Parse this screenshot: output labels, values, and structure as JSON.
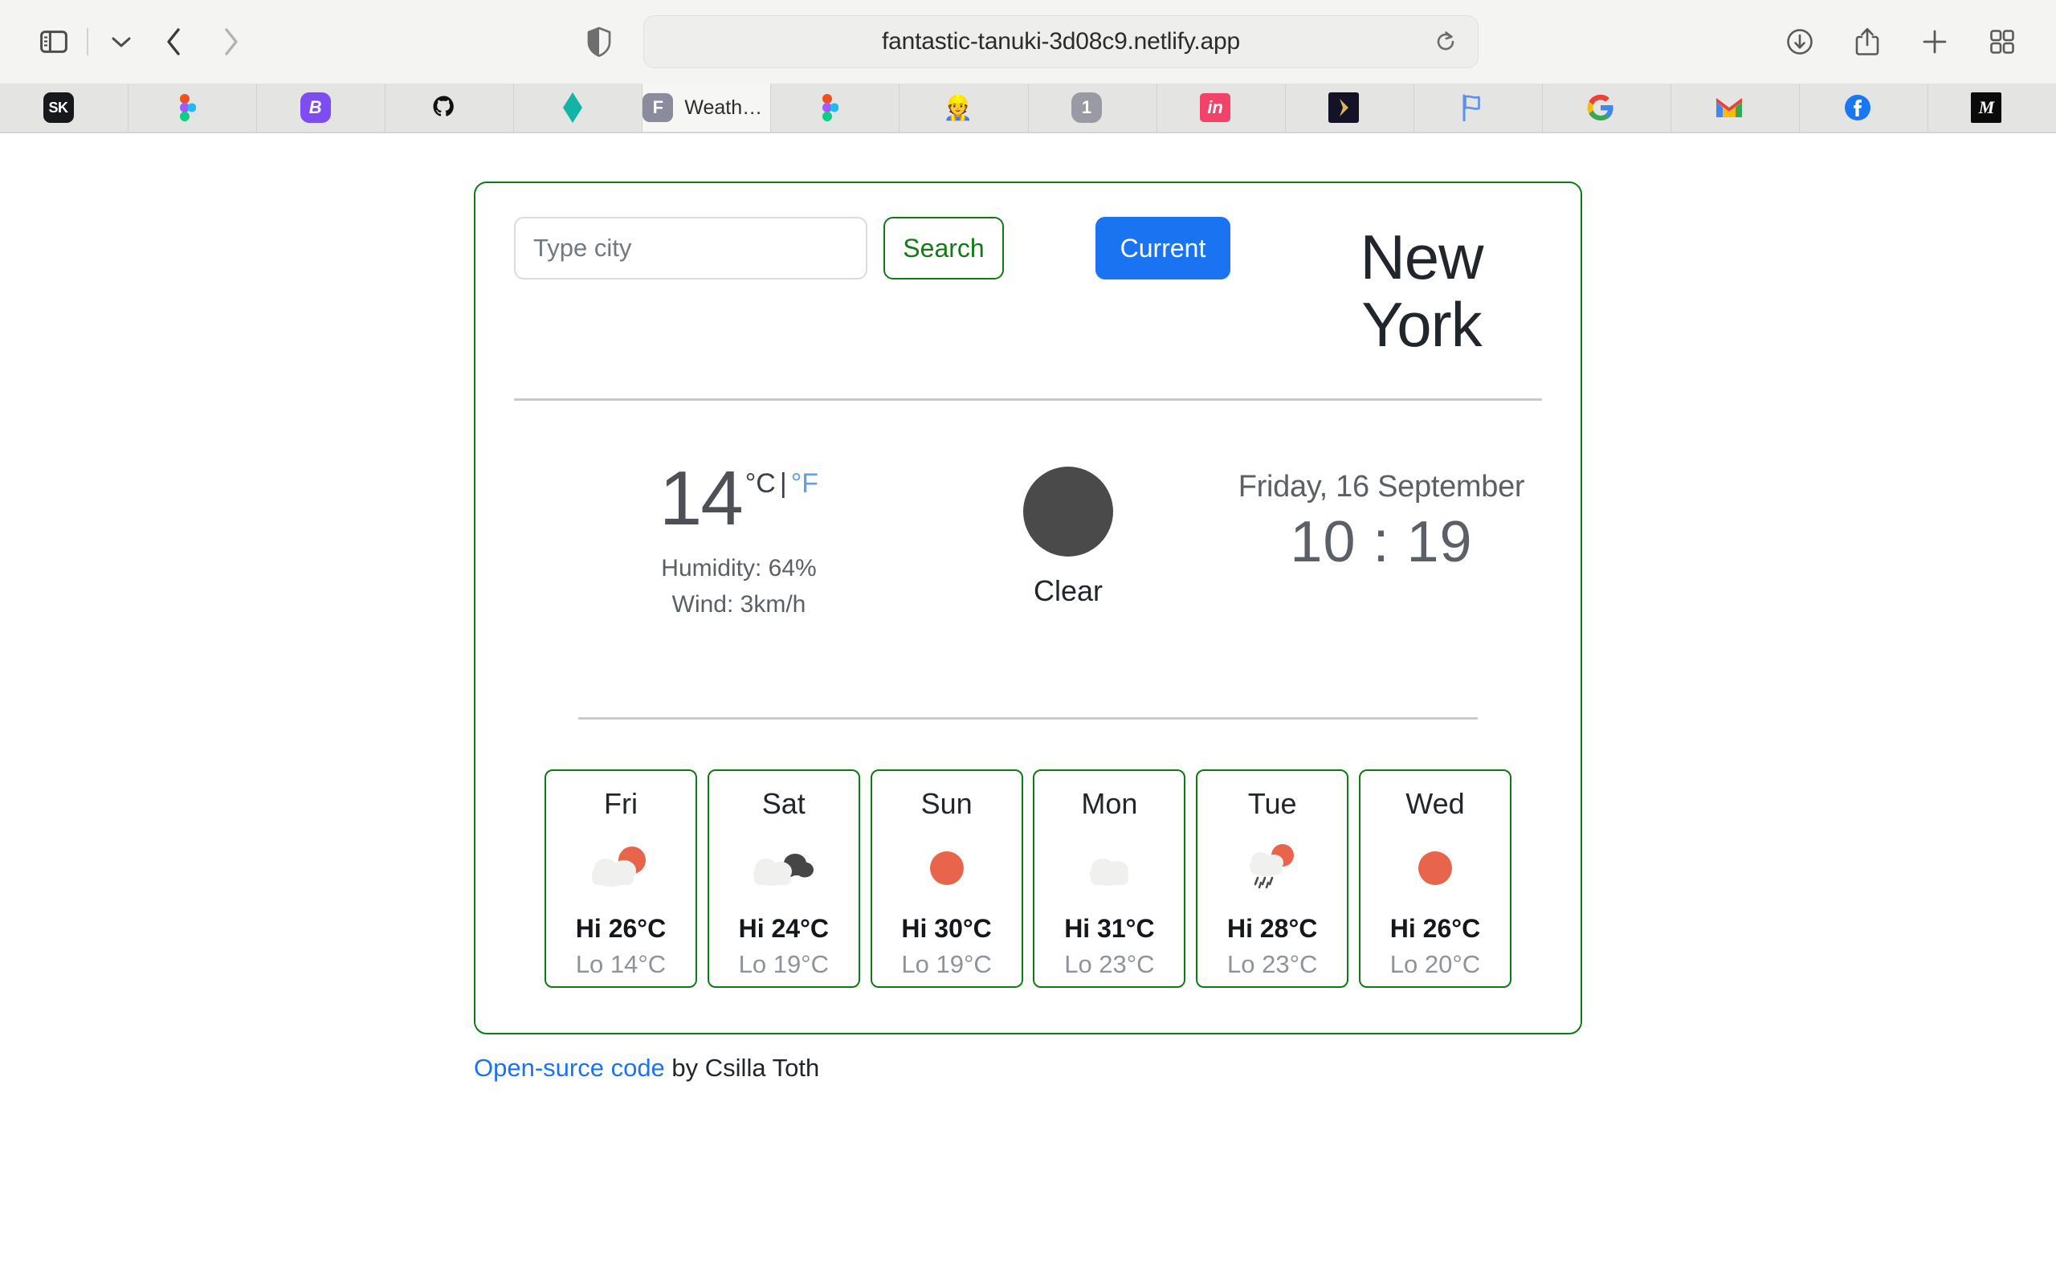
{
  "browser": {
    "url": "fantastic-tanuki-3d08c9.netlify.app",
    "icons": {
      "sidebar": "sidebar-icon",
      "sidebar_chevron": "chevron-down-icon",
      "back": "back-arrow-icon",
      "forward": "forward-arrow-icon",
      "shield": "privacy-shield-icon",
      "reload": "reload-icon",
      "downloads": "downloads-icon",
      "share": "share-icon",
      "new_tab": "plus-icon",
      "tab_overview": "tab-overview-icon"
    },
    "tabs": [
      {
        "favicon": "sk-icon",
        "title": "",
        "active": false
      },
      {
        "favicon": "figma-icon",
        "title": "",
        "active": false
      },
      {
        "favicon": "bitly-icon",
        "title": "",
        "active": false
      },
      {
        "favicon": "github-icon",
        "title": "",
        "active": false
      },
      {
        "favicon": "diamond-icon",
        "title": "",
        "active": false
      },
      {
        "favicon": "f-icon",
        "title": "Weather…",
        "active": true
      },
      {
        "favicon": "figma-icon",
        "title": "",
        "active": false
      },
      {
        "favicon": "construction-worker-icon",
        "title": "",
        "active": false
      },
      {
        "favicon": "one-icon",
        "title": "",
        "active": false
      },
      {
        "favicon": "invision-icon",
        "title": "",
        "active": false
      },
      {
        "favicon": "play-icon",
        "title": "",
        "active": false
      },
      {
        "favicon": "flag-icon",
        "title": "",
        "active": false
      },
      {
        "favicon": "google-icon",
        "title": "",
        "active": false
      },
      {
        "favicon": "gmail-icon",
        "title": "",
        "active": false
      },
      {
        "favicon": "facebook-icon",
        "title": "",
        "active": false
      },
      {
        "favicon": "medium-icon",
        "title": "",
        "active": false
      }
    ]
  },
  "app": {
    "search": {
      "placeholder": "Type city",
      "value": "",
      "search_label": "Search",
      "current_label": "Current"
    },
    "city": "New York",
    "current": {
      "temperature": "14",
      "unit_celsius": "°C",
      "unit_separator": "|",
      "unit_fahrenheit": "°F",
      "humidity": "Humidity: 64%",
      "wind": "Wind: 3km/h",
      "condition": "Clear",
      "condition_icon": "clear-weather-icon",
      "date": "Friday, 16 September",
      "time": "10 : 19"
    },
    "forecast": [
      {
        "day": "Fri",
        "icon": "sun-behind-cloud-icon",
        "hi": "Hi 26°C",
        "lo": "Lo 14°C"
      },
      {
        "day": "Sat",
        "icon": "dark-clouds-icon",
        "hi": "Hi 24°C",
        "lo": "Lo 19°C"
      },
      {
        "day": "Sun",
        "icon": "sun-icon",
        "hi": "Hi 30°C",
        "lo": "Lo 19°C"
      },
      {
        "day": "Mon",
        "icon": "cloud-icon",
        "hi": "Hi 31°C",
        "lo": "Lo 23°C"
      },
      {
        "day": "Tue",
        "icon": "sun-rain-cloud-icon",
        "hi": "Hi 28°C",
        "lo": "Lo 23°C"
      },
      {
        "day": "Wed",
        "icon": "sun-icon",
        "hi": "Hi 26°C",
        "lo": "Lo 20°C"
      }
    ],
    "footer": {
      "link_text": "Open-surce code",
      "suffix_text": " by Csilla Toth"
    },
    "colors": {
      "accent_green": "#0f7a12",
      "accent_blue": "#1a73f0",
      "link_blue": "#1a73f0",
      "sun_orange": "#e8644a",
      "cloud_light": "#f0f0ee",
      "cloud_dark": "#464646",
      "condition_circle": "#4a4a4a"
    }
  }
}
